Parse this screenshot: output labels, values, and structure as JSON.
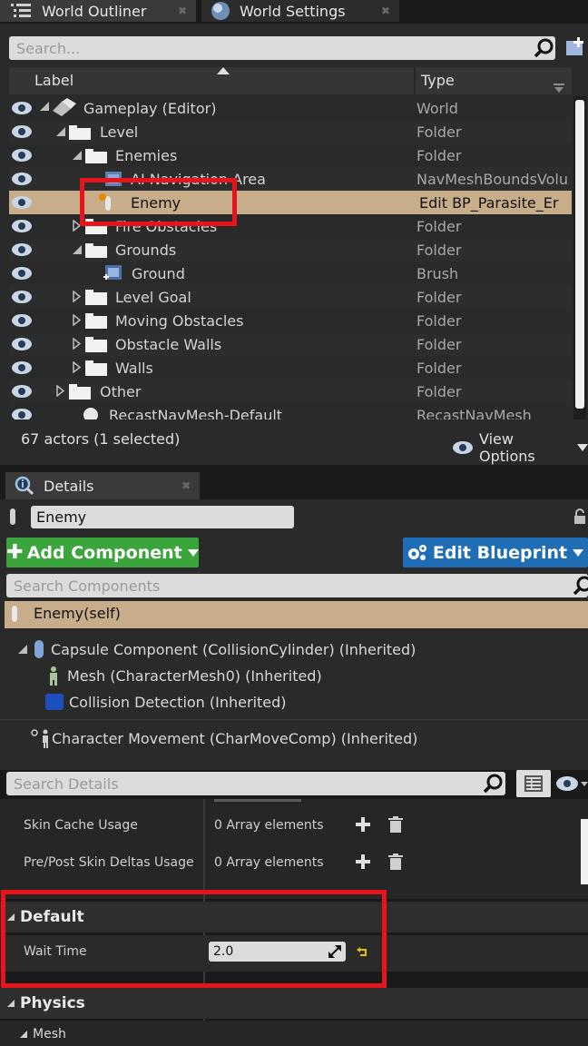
{
  "tabs": [
    {
      "label": "World Outliner",
      "icon": "outliner-icon"
    },
    {
      "label": "World Settings",
      "icon": "globe-icon"
    }
  ],
  "outliner": {
    "search_placeholder": "Search...",
    "col_label": "Label",
    "col_type": "Type",
    "rows": [
      {
        "label": "Gameplay (Editor)",
        "type": "World"
      },
      {
        "label": "Level",
        "type": "Folder"
      },
      {
        "label": "Enemies",
        "type": "Folder"
      },
      {
        "label": "AI Navigation Area",
        "type": "NavMeshBoundsVolu"
      },
      {
        "label": "Enemy",
        "type": "Edit BP_Parasite_Er"
      },
      {
        "label": "Fire Obstacles",
        "type": "Folder"
      },
      {
        "label": "Grounds",
        "type": "Folder"
      },
      {
        "label": "Ground",
        "type": "Brush"
      },
      {
        "label": "Level Goal",
        "type": "Folder"
      },
      {
        "label": "Moving Obstacles",
        "type": "Folder"
      },
      {
        "label": "Obstacle Walls",
        "type": "Folder"
      },
      {
        "label": "Walls",
        "type": "Folder"
      },
      {
        "label": "Other",
        "type": "Folder"
      },
      {
        "label": "RecastNavMesh-Default",
        "type": "RecastNavMesh"
      }
    ],
    "status": "67 actors (1 selected)",
    "view_options": "View Options"
  },
  "details": {
    "tab_label": "Details",
    "name_value": "Enemy",
    "add_component": "Add Component",
    "edit_blueprint": "Edit Blueprint",
    "search_components_placeholder": "Search Components",
    "self_label": "Enemy(self)",
    "components": [
      {
        "label": "Capsule Component (CollisionCylinder) (Inherited)"
      },
      {
        "label": "Mesh (CharacterMesh0) (Inherited)"
      },
      {
        "label": "Collision Detection (Inherited)"
      },
      {
        "label": "Character Movement (CharMoveComp) (Inherited)"
      }
    ],
    "search_details_placeholder": "Search Details",
    "props": [
      {
        "name": "Skin Cache Usage",
        "value": "0 Array elements"
      },
      {
        "name": "Pre/Post Skin Deltas Usage",
        "value": "0 Array elements"
      }
    ],
    "section_default": "Default",
    "wait_time_label": "Wait Time",
    "wait_time_value": "2.0",
    "section_physics": "Physics",
    "section_mesh": "Mesh"
  },
  "colors": {
    "selection": "#c7ad8a",
    "highlight_red": "#e8141c",
    "add_green": "#3aa53a",
    "blueprint_blue": "#1f6db5"
  }
}
